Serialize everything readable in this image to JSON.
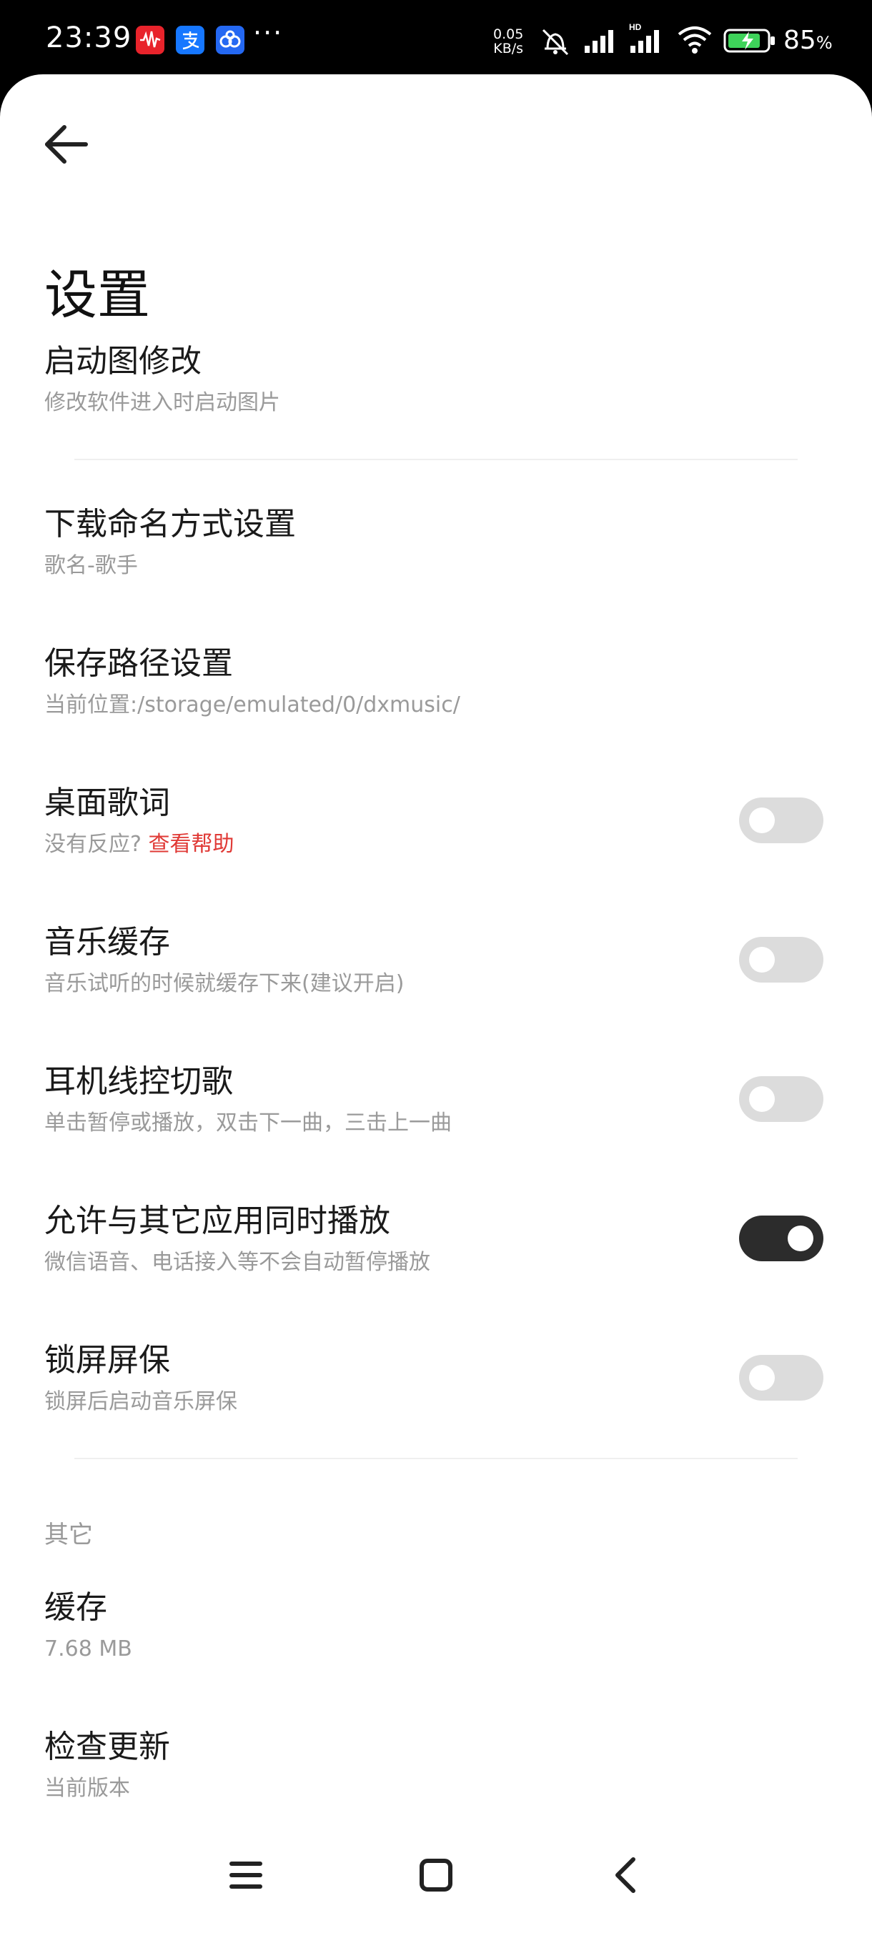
{
  "status_bar": {
    "time": "23:39",
    "app_icons": [
      {
        "icon": "voice-wave-icon",
        "color": "#e8232b"
      },
      {
        "icon": "alipay-icon",
        "color": "#1677ff"
      },
      {
        "icon": "baidu-netdisk-icon",
        "color": "#2468f2"
      }
    ],
    "more": "···",
    "net_speed_value": "0.05",
    "net_speed_unit": "KB/s",
    "battery_percent": "85",
    "percent_sign": "%"
  },
  "header": {
    "back_icon": "arrow-left-icon",
    "title": "设置"
  },
  "settings": [
    {
      "title": "启动图修改",
      "subtitle": "修改软件进入时启动图片"
    },
    {
      "title": "下载命名方式设置",
      "subtitle": "歌名-歌手"
    },
    {
      "title": "保存路径设置",
      "subtitle": "当前位置:/storage/emulated/0/dxmusic/"
    },
    {
      "title": "桌面歌词",
      "subtitle": "没有反应?",
      "subtitle_link": "查看帮助",
      "toggle": false
    },
    {
      "title": "音乐缓存",
      "subtitle": "音乐试听的时候就缓存下来(建议开启)",
      "toggle": false
    },
    {
      "title": "耳机线控切歌",
      "subtitle": "单击暂停或播放，双击下一曲，三击上一曲",
      "toggle": false
    },
    {
      "title": "允许与其它应用同时播放",
      "subtitle": "微信语音、电话接入等不会自动暂停播放",
      "toggle": true
    },
    {
      "title": "锁屏屏保",
      "subtitle": "锁屏后启动音乐屏保",
      "toggle": false
    }
  ],
  "other_section": {
    "label": "其它",
    "items": [
      {
        "title": "缓存",
        "subtitle": "7.68 MB"
      },
      {
        "title": "检查更新",
        "subtitle": "当前版本"
      }
    ]
  },
  "nav_bar": {
    "icons": [
      "menu-icon",
      "home-icon",
      "back-icon"
    ]
  },
  "colors": {
    "accent_link": "#e03a36",
    "toggle_on": "#2c2c2c",
    "toggle_off": "#dcdcdc"
  }
}
